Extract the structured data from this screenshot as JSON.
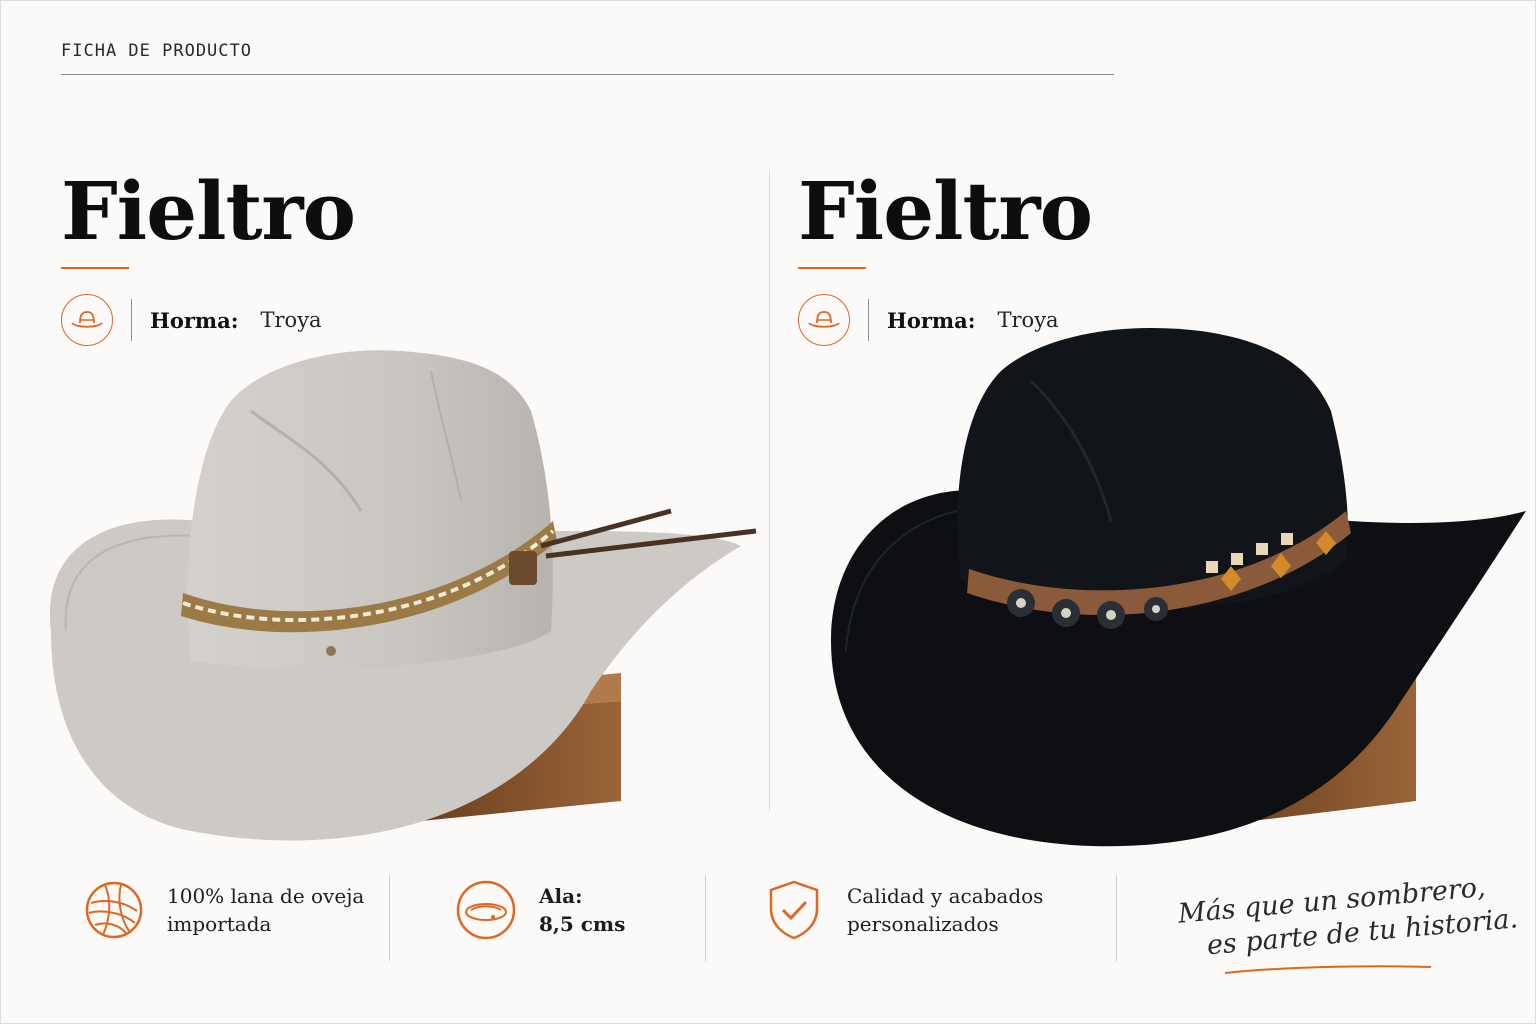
{
  "header": {
    "eyebrow": "FICHA DE PRODUCTO"
  },
  "products": [
    {
      "title": "Fieltro",
      "spec_label": "Horma:",
      "spec_value": "Troya",
      "hat_color": "#c9c6c1"
    },
    {
      "title": "Fieltro",
      "spec_label": "Horma:",
      "spec_value": "Troya",
      "hat_color": "#0e1013"
    }
  ],
  "features": [
    {
      "icon": "wool-ball-icon",
      "line1": "100% lana de oveja",
      "line2": "importada"
    },
    {
      "icon": "hat-brim-icon",
      "line1": "Ala:",
      "line2": "8,5 cms"
    },
    {
      "icon": "shield-check-icon",
      "line1": "Calidad y acabados",
      "line2": "personalizados"
    }
  ],
  "tagline": {
    "line1": "Más que un sombrero,",
    "line2": "es parte de tu historia."
  },
  "colors": {
    "accent": "#e0671f",
    "text": "#0d0d0d",
    "wood": "#7a4a28"
  }
}
